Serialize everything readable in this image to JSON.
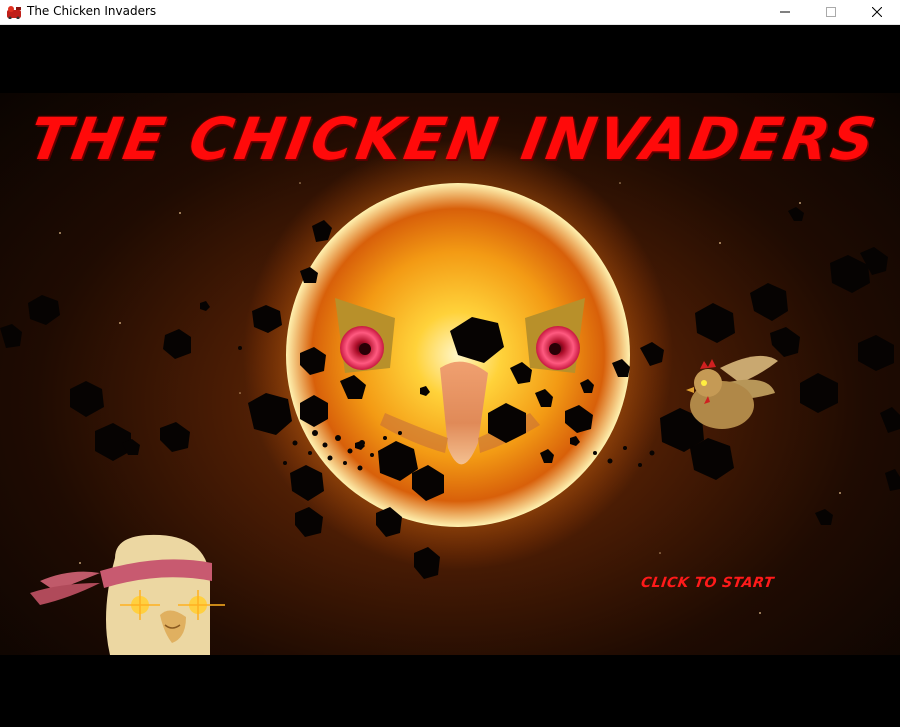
{
  "window": {
    "title": "The Chicken Invaders",
    "icon": "chicken-app-icon",
    "controls": [
      "minimize-icon",
      "maximize-icon",
      "close-icon"
    ]
  },
  "game": {
    "title": "THE CHICKEN INVADERS",
    "start_label": "CLICK TO START",
    "colors": {
      "title": "#ff0a0a",
      "start": "#ff1a1a",
      "sun_core": "#fff6c8",
      "sun_outer": "#f07a10",
      "background": "#000000"
    },
    "sprites": [
      "sun",
      "chicken-boss-face",
      "asteroid-field",
      "flying-chicken",
      "headband-chicken-hero"
    ]
  }
}
